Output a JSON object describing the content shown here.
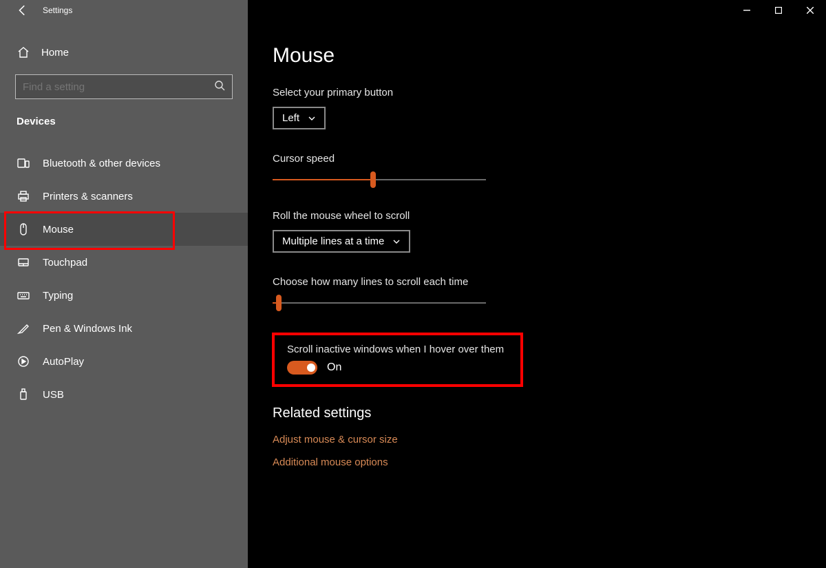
{
  "titlebar": {
    "title": "Settings"
  },
  "sidebar": {
    "home": "Home",
    "search_placeholder": "Find a setting",
    "category": "Devices",
    "items": [
      {
        "id": "bluetooth",
        "label": "Bluetooth & other devices"
      },
      {
        "id": "printers",
        "label": "Printers & scanners"
      },
      {
        "id": "mouse",
        "label": "Mouse"
      },
      {
        "id": "touchpad",
        "label": "Touchpad"
      },
      {
        "id": "typing",
        "label": "Typing"
      },
      {
        "id": "pen",
        "label": "Pen & Windows Ink"
      },
      {
        "id": "autoplay",
        "label": "AutoPlay"
      },
      {
        "id": "usb",
        "label": "USB"
      }
    ]
  },
  "main": {
    "title": "Mouse",
    "primary_button_label": "Select your primary button",
    "primary_button_value": "Left",
    "cursor_speed_label": "Cursor speed",
    "cursor_speed_percent": 47,
    "scroll_mode_label": "Roll the mouse wheel to scroll",
    "scroll_mode_value": "Multiple lines at a time",
    "lines_label": "Choose how many lines to scroll each time",
    "lines_percent": 3,
    "inactive_label": "Scroll inactive windows when I hover over them",
    "inactive_state": "On",
    "related_title": "Related settings",
    "link1": "Adjust mouse & cursor size",
    "link2": "Additional mouse options"
  }
}
